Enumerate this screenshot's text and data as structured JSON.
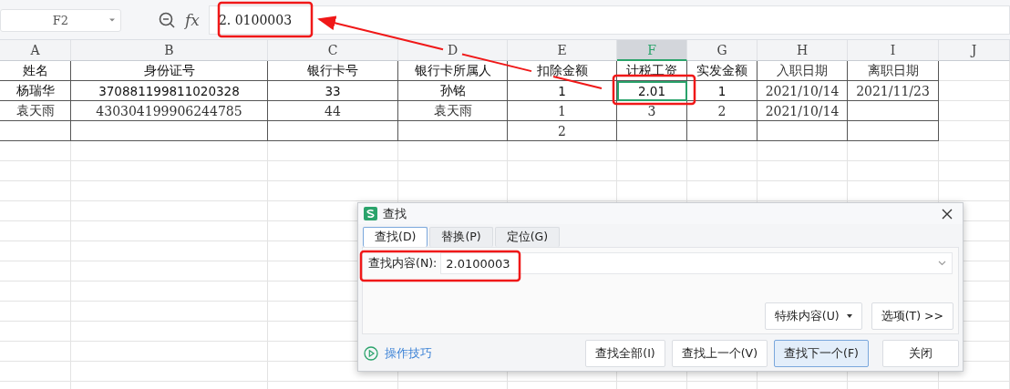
{
  "formula_bar": {
    "name_box": "F2",
    "fx_label": "fx",
    "value": "2. 0100003"
  },
  "sheet": {
    "columns": [
      {
        "label": "A",
        "selected": false
      },
      {
        "label": "B",
        "selected": false
      },
      {
        "label": "C",
        "selected": false
      },
      {
        "label": "D",
        "selected": false
      },
      {
        "label": "E",
        "selected": false
      },
      {
        "label": "F",
        "selected": true
      },
      {
        "label": "G",
        "selected": false
      },
      {
        "label": "H",
        "selected": false
      },
      {
        "label": "I",
        "selected": false
      },
      {
        "label": "J",
        "selected": false
      }
    ],
    "rows": [
      {
        "cells": [
          {
            "text": "姓名",
            "kind": "sans",
            "selected": false
          },
          {
            "text": "身份证号",
            "kind": "sans",
            "selected": false
          },
          {
            "text": "银行卡号",
            "kind": "sans",
            "selected": false
          },
          {
            "text": "银行卡所属人",
            "kind": "sans",
            "selected": false
          },
          {
            "text": "扣除金额",
            "kind": "sans",
            "selected": false
          },
          {
            "text": "计税工资",
            "kind": "sans",
            "selected": false
          },
          {
            "text": "实发金额",
            "kind": "sans",
            "selected": false
          },
          {
            "text": "入职日期",
            "kind": "serif",
            "selected": false
          },
          {
            "text": "离职日期",
            "kind": "serif",
            "selected": false
          }
        ]
      },
      {
        "cells": [
          {
            "text": "杨瑞华",
            "kind": "sans",
            "selected": false
          },
          {
            "text": "370881199811020328",
            "kind": "sans",
            "selected": false
          },
          {
            "text": "33",
            "kind": "sans",
            "selected": false
          },
          {
            "text": "孙铭",
            "kind": "sans",
            "selected": false
          },
          {
            "text": "1",
            "kind": "sans",
            "selected": false
          },
          {
            "text": "2.01",
            "kind": "sans",
            "selected": true
          },
          {
            "text": "1",
            "kind": "sans",
            "selected": false
          },
          {
            "text": "2021/10/14",
            "kind": "serif",
            "selected": false
          },
          {
            "text": "2021/11/23",
            "kind": "serif",
            "selected": false
          }
        ]
      },
      {
        "cells": [
          {
            "text": "袁天雨",
            "kind": "serif",
            "selected": false
          },
          {
            "text": "430304199906244785",
            "kind": "serif",
            "selected": false
          },
          {
            "text": "44",
            "kind": "serif",
            "selected": false
          },
          {
            "text": "袁天雨",
            "kind": "serif",
            "selected": false
          },
          {
            "text": "1",
            "kind": "serif",
            "selected": false
          },
          {
            "text": "3",
            "kind": "serif",
            "selected": false
          },
          {
            "text": "2",
            "kind": "serif",
            "selected": false
          },
          {
            "text": "2021/10/14",
            "kind": "serif",
            "selected": false
          },
          {
            "kind": "empty",
            "selected": false
          }
        ]
      },
      {
        "cells": [
          {
            "kind": "empty",
            "selected": false
          },
          {
            "kind": "empty",
            "selected": false
          },
          {
            "kind": "empty",
            "selected": false
          },
          {
            "kind": "empty",
            "selected": false
          },
          {
            "text": "2",
            "kind": "serif",
            "selected": false
          },
          {
            "kind": "empty",
            "selected": false
          },
          {
            "kind": "empty",
            "selected": false
          },
          {
            "kind": "empty",
            "selected": false
          },
          {
            "kind": "empty",
            "selected": false
          }
        ]
      }
    ]
  },
  "find_dialog": {
    "title": "查找",
    "tabs": [
      {
        "label": "查找(D)",
        "selected": true
      },
      {
        "label": "替换(P)",
        "selected": false
      },
      {
        "label": "定位(G)",
        "selected": false
      }
    ],
    "find_label": "查找内容(N):",
    "find_value": "2.0100003",
    "option_buttons": [
      {
        "label": "特殊内容(U)",
        "kind": "dropdown"
      },
      {
        "label": "选项(T) >>",
        "kind": "plain"
      }
    ],
    "tips_link": "操作技巧",
    "buttons": [
      {
        "label": "查找全部(I)",
        "selected": false
      },
      {
        "label": "查找上一个(V)",
        "selected": false
      },
      {
        "label": "查找下一个(F)",
        "selected": true
      },
      {
        "label": "关闭",
        "selected": false
      }
    ]
  }
}
